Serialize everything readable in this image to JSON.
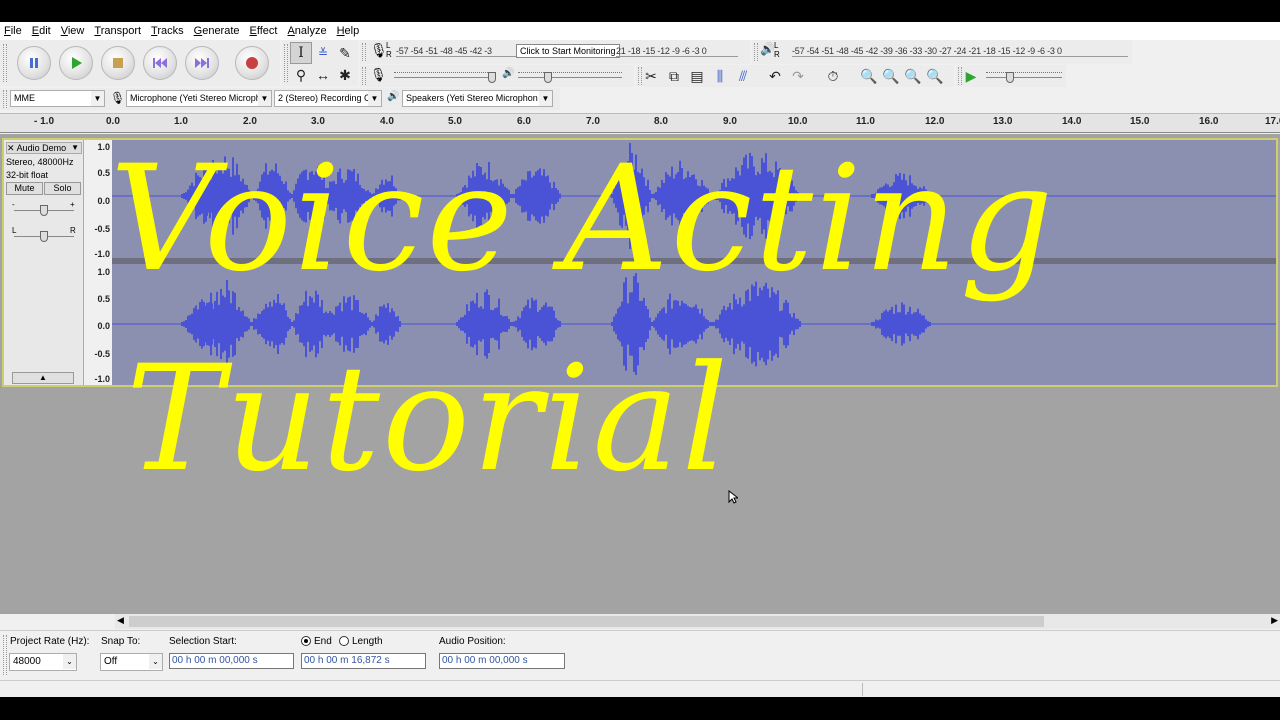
{
  "menu": [
    "File",
    "Edit",
    "View",
    "Transport",
    "Tracks",
    "Generate",
    "Effect",
    "Analyze",
    "Help"
  ],
  "transport": {
    "pause": "pause-button",
    "play": "play-button",
    "stop": "stop-button",
    "skip_start": "skip-to-start-button",
    "skip_end": "skip-to-end-button",
    "record": "record-button"
  },
  "meters": {
    "record_scale": "-57 -54 -51 -48 -45 -42 -3",
    "record_scale_tail": "21 -18 -15 -12 -9 -6 -3 0",
    "monitor_tooltip": "Click to Start Monitoring",
    "play_scale": "-57 -54 -51 -48 -45 -42 -39 -36 -33 -30 -27 -24 -21 -18 -15 -12 -9 -6 -3 0",
    "lr_L": "L",
    "lr_R": "R"
  },
  "device": {
    "host": "MME",
    "mic": "Microphone (Yeti Stereo Microph",
    "channels": "2 (Stereo) Recording C",
    "speakers": "Speakers (Yeti Stereo Microphon"
  },
  "ruler": {
    "labels": [
      "- 1.0",
      "0.0",
      "1.0",
      "2.0",
      "3.0",
      "4.0",
      "5.0",
      "6.0",
      "7.0",
      "8.0",
      "9.0",
      "10.0",
      "11.0",
      "12.0",
      "13.0",
      "14.0",
      "15.0",
      "16.0",
      "17.0"
    ]
  },
  "track": {
    "name": "Audio Demo",
    "info1": "Stereo, 48000Hz",
    "info2": "32-bit float",
    "mute": "Mute",
    "solo": "Solo",
    "scale_top": [
      "1.0",
      "0.5",
      "0.0",
      "-0.5",
      "-1.0"
    ],
    "scale_bottom": [
      "1.0",
      "0.5",
      "0.0",
      "-0.5",
      "-1.0"
    ],
    "gain_minus": "-",
    "gain_plus": "+",
    "pan_l": "L",
    "pan_r": "R"
  },
  "overlay": {
    "line1": "Voice Acting",
    "line2": "Tutorial",
    "color": "#ffff00"
  },
  "selection": {
    "project_rate_label": "Project Rate (Hz):",
    "project_rate": "48000",
    "snap_label": "Snap To:",
    "snap": "Off",
    "start_label": "Selection Start:",
    "end_label": "End",
    "length_label": "Length",
    "start": "00 h 00 m 00,000 s",
    "end": "00 h 00 m 16,872 s",
    "audio_pos_label": "Audio Position:",
    "audio_pos": "00 h 00 m 00,000 s"
  },
  "colors": {
    "waveform": "#4a52d6",
    "wave_bg": "#8b8fb0",
    "track_border": "#cfcd6e"
  }
}
